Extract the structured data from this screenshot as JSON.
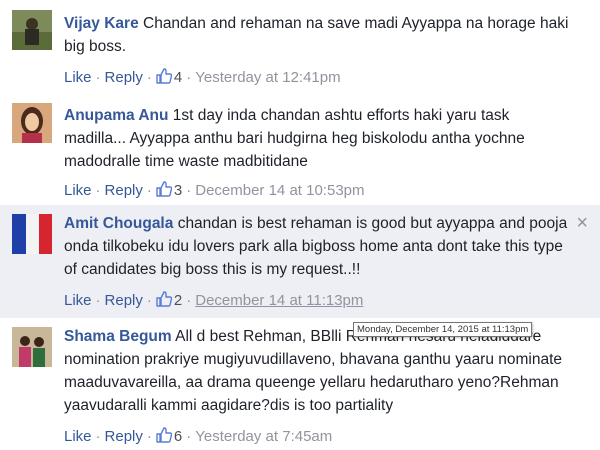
{
  "actions": {
    "like_label": "Like",
    "reply_label": "Reply",
    "separator": "·"
  },
  "comments": [
    {
      "author": "Vijay Kare",
      "text": "Chandan and rehaman na save madi Ayyappa na horage haki big boss.",
      "likes": "4",
      "timestamp": "Yesterday at 12:41pm"
    },
    {
      "author": "Anupama Anu",
      "text": "1st day inda chandan ashtu efforts haki yaru task madilla... Ayyappa anthu bari hudgirna heg biskolodu antha yochne madodralle time waste madbitidane",
      "likes": "3",
      "timestamp": "December 14 at 10:53pm"
    },
    {
      "author": "Amit Chougala",
      "text": "chandan is best rehaman is good but ayyappa and pooja onda tilkobeku idu lovers park alla bigboss home anta dont take this type of candidates big boss this is my request..!!",
      "likes": "2",
      "timestamp": "December 14 at 11:13pm"
    },
    {
      "author": "Shama Begum",
      "text": "All d best Rehman, BBlli Rehman hesaru heladiddare nomination prakriye mugiyuvudillaveno, bhavana ganthu yaaru nominate maaduvavareilla, aa drama queenge yellaru hedarutharo yeno?Rehman yaavudaralli kammi aagidare?dis is too partiality",
      "likes": "6",
      "timestamp": "Yesterday at 7:45am"
    }
  ],
  "tooltip": {
    "text": "Monday, December 14, 2015 at 11:13pm"
  },
  "close_glyph": "×",
  "colors": {
    "author": "#365899",
    "text": "#1d2129",
    "meta": "#90949c",
    "highlight_bg": "#edeff4"
  }
}
